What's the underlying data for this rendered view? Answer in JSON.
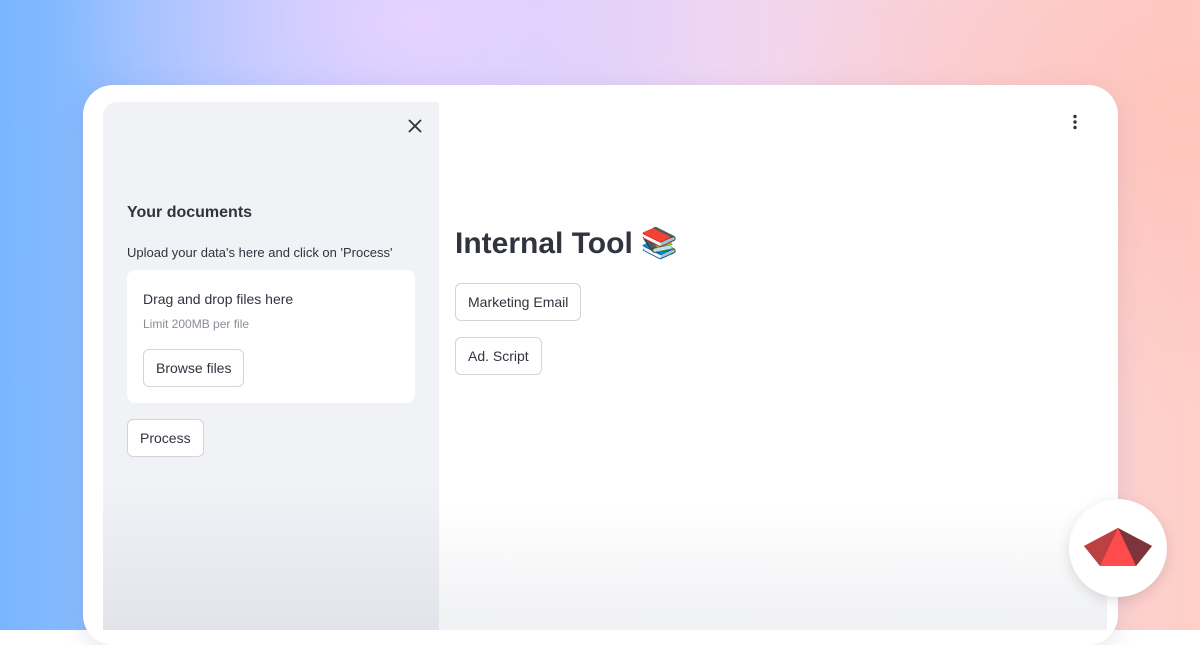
{
  "sidebar": {
    "title": "Your documents",
    "upload_label": "Upload your data's here and click on 'Process'",
    "dropzone": {
      "title": "Drag and drop files here",
      "limit": "Limit 200MB per file",
      "browse_label": "Browse files"
    },
    "process_label": "Process"
  },
  "main": {
    "title": "Internal Tool",
    "title_emoji": "📚",
    "buttons": {
      "marketing_email": "Marketing Email",
      "ad_script": "Ad. Script"
    }
  },
  "icons": {
    "close": "close-icon",
    "menu": "kebab-menu-icon",
    "logo": "streamlit-logo-icon"
  },
  "colors": {
    "text": "#31333f",
    "sidebar_bg": "#f0f2f6",
    "brand_red": "#ff4b4b"
  }
}
